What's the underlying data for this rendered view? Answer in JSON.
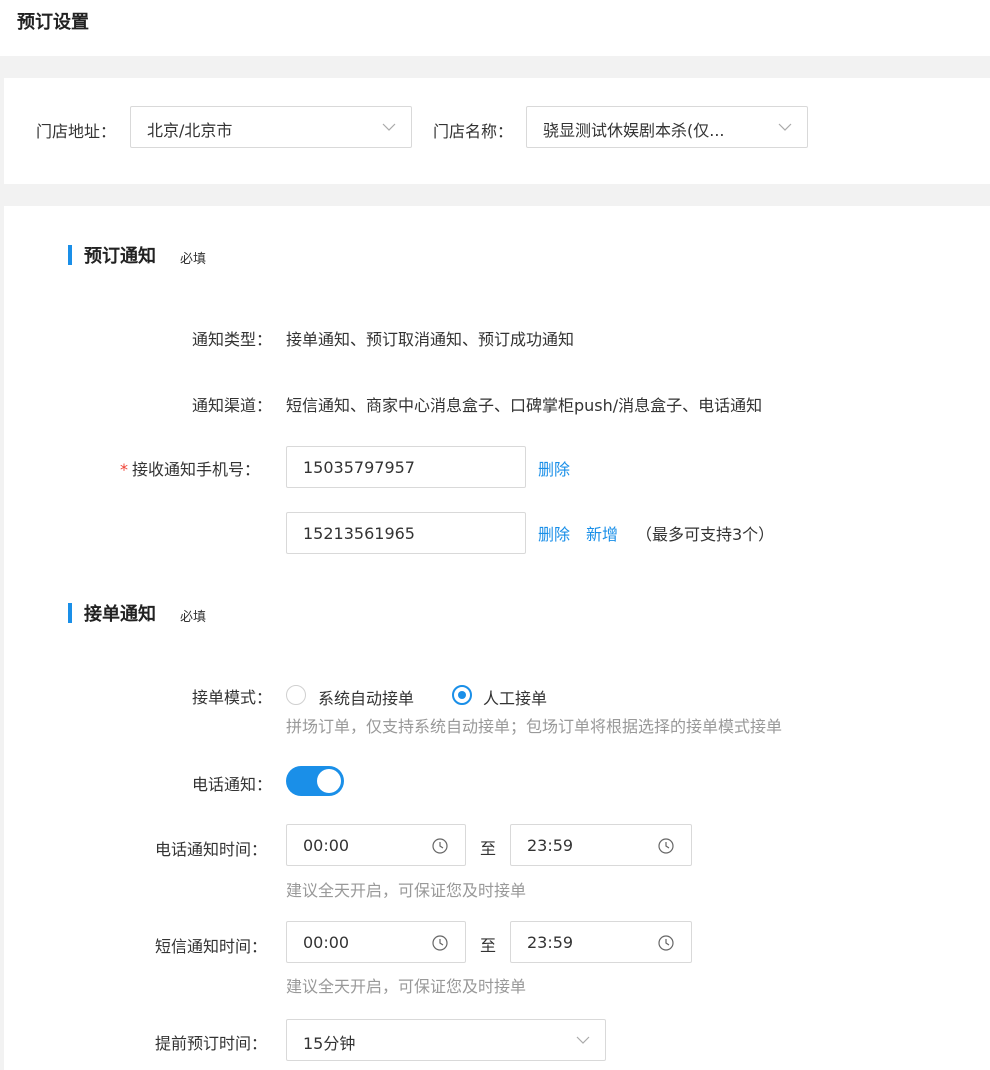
{
  "page": {
    "title": "预订设置"
  },
  "filters": {
    "address_label": "门店地址：",
    "address_value": "北京/北京市",
    "store_label": "门店名称：",
    "store_value": "骁显测试休娱剧本杀(仅..."
  },
  "booking_notice": {
    "title": "预订通知",
    "required": "必填",
    "type_label": "通知类型：",
    "type_value": "接单通知、预订取消通知、预订成功通知",
    "channel_label": "通知渠道：",
    "channel_value": "短信通知、商家中心消息盒子、口碑掌柜push/消息盒子、电话通知",
    "phone_label": "接收通知手机号：",
    "phones": [
      "15035797957",
      "15213561965"
    ],
    "delete_label": "删除",
    "add_label": "新增",
    "max_hint": "（最多可支持3个）"
  },
  "order_notice": {
    "title": "接单通知",
    "required": "必填",
    "mode_label": "接单模式：",
    "mode_options": [
      "系统自动接单",
      "人工接单"
    ],
    "mode_selected": "人工接单",
    "mode_hint": "拼场订单，仅支持系统自动接单；包场订单将根据选择的接单模式接单",
    "phone_notice_label": "电话通知：",
    "phone_notice_on": true,
    "phone_time_label": "电话通知时间：",
    "phone_time_start": "00:00",
    "phone_time_end": "23:59",
    "to_label": "至",
    "phone_time_hint": "建议全天开启，可保证您及时接单",
    "sms_time_label": "短信通知时间：",
    "sms_time_start": "00:00",
    "sms_time_end": "23:59",
    "sms_time_hint": "建议全天开启，可保证您及时接单",
    "advance_label": "提前预订时间：",
    "advance_value": "15分钟"
  },
  "colors": {
    "accent": "#1a8fe8",
    "required_star": "#f04134",
    "hint": "#999999"
  },
  "icons": {
    "select_arrow": "chevron-down-icon",
    "time": "clock-icon"
  }
}
